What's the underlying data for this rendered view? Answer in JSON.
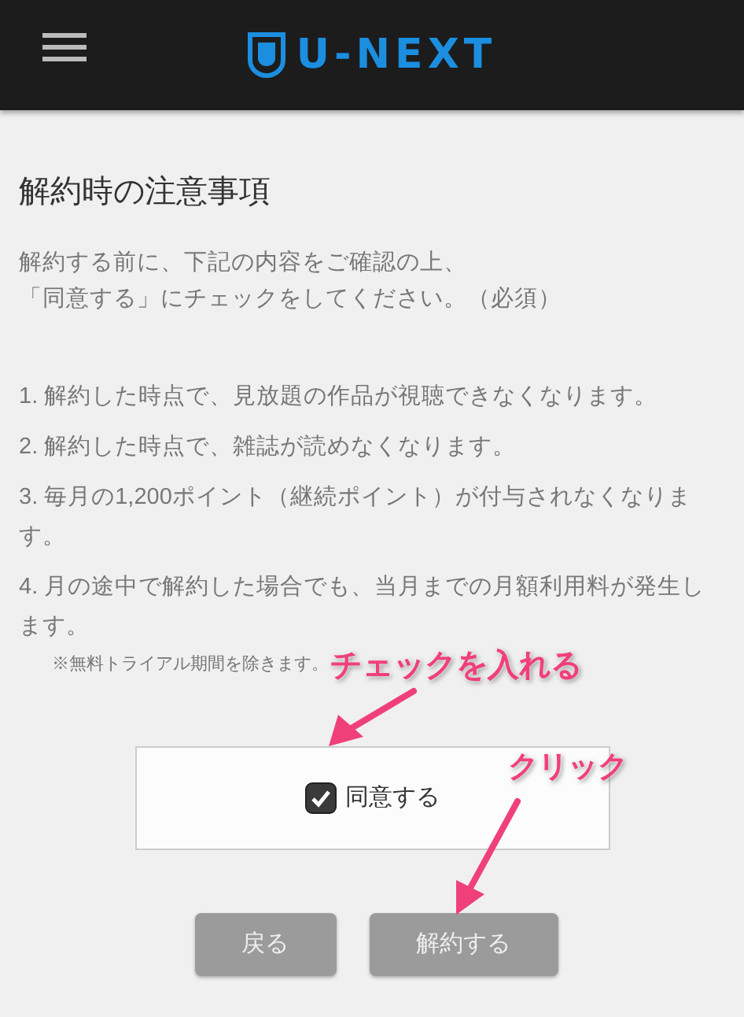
{
  "header": {
    "logo_text": "U-NEXT"
  },
  "title": "解約時の注意事項",
  "intro": [
    "解約する前に、下記の内容をご確認の上、",
    "「同意する」にチェックをしてください。（必須）"
  ],
  "notes": [
    {
      "text": "1. 解約した時点で、見放題の作品が視聴できなくなります。"
    },
    {
      "text": "2. 解約した時点で、雑誌が読めなくなります。"
    },
    {
      "text": "3. 毎月の1,200ポイント（継続ポイント）が付与されなくなります。"
    },
    {
      "text": "4. 月の途中で解約した場合でも、当月までの月額利用料が発生します。",
      "remark": "※無料トライアル期間を除きます。"
    }
  ],
  "agree": {
    "label": "同意する",
    "checked": true
  },
  "buttons": [
    {
      "label": "戻る"
    },
    {
      "label": "解約する"
    }
  ],
  "annotations": [
    {
      "text": "チェックを入れる"
    },
    {
      "text": "クリック"
    }
  ]
}
